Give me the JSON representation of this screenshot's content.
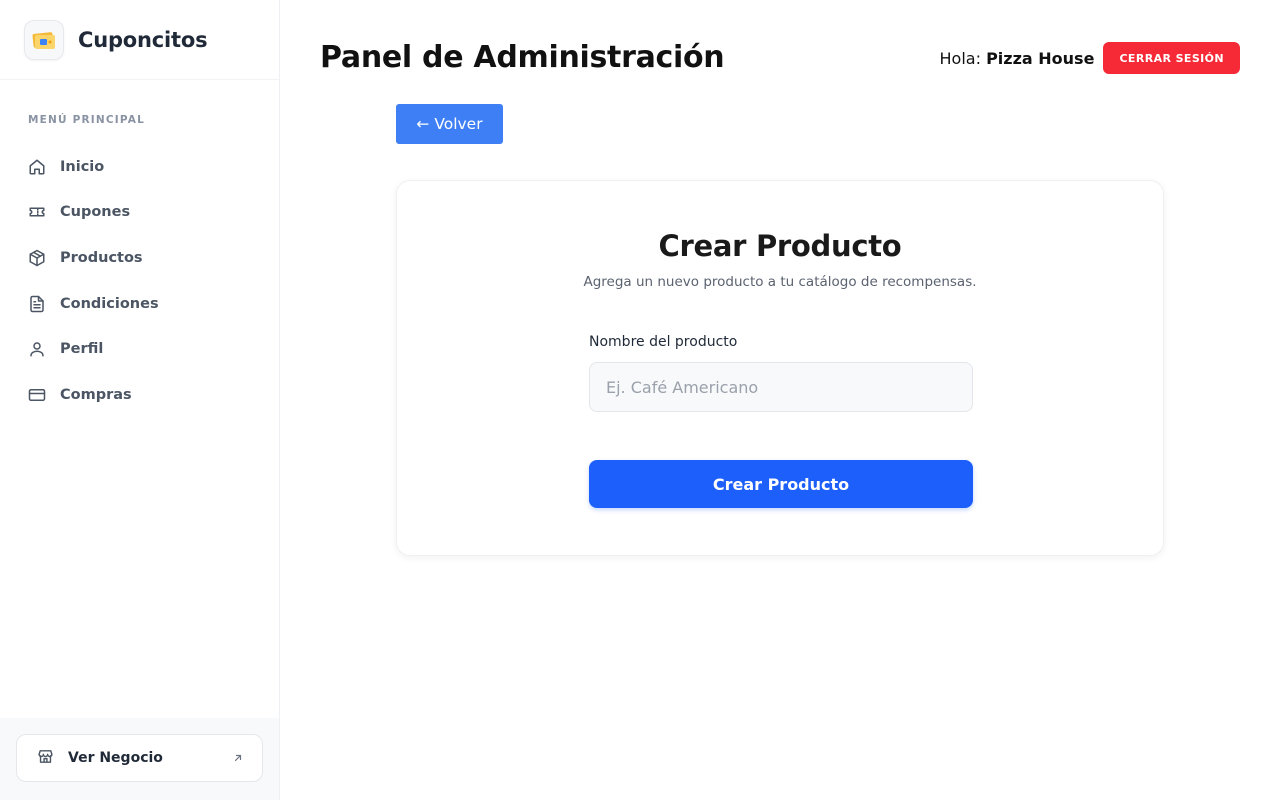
{
  "brand": {
    "name": "Cuponcitos",
    "logo_icon": "coupon-ticket-icon"
  },
  "sidebar": {
    "heading": "MENÚ PRINCIPAL",
    "items": [
      {
        "label": "Inicio",
        "icon": "home-icon"
      },
      {
        "label": "Cupones",
        "icon": "ticket-icon"
      },
      {
        "label": "Productos",
        "icon": "box-icon"
      },
      {
        "label": "Condiciones",
        "icon": "document-icon"
      },
      {
        "label": "Perfil",
        "icon": "user-icon"
      },
      {
        "label": "Compras",
        "icon": "credit-card-icon"
      }
    ],
    "footer": {
      "label": "Ver Negocio",
      "icon": "store-icon",
      "trailing_icon": "arrow-up-right-icon"
    }
  },
  "header": {
    "title": "Panel de Administración",
    "greeting": "Hola:",
    "user": "Pizza House",
    "logout_label": "CERRAR SESIÓN"
  },
  "back_button": {
    "label": "← Volver"
  },
  "form": {
    "title": "Crear Producto",
    "subtitle": "Agrega un nuevo producto a tu catálogo de recompensas.",
    "field_label": "Nombre del producto",
    "field_value": "",
    "field_placeholder": "Ej. Café Americano",
    "submit_label": "Crear Producto"
  },
  "colors": {
    "primary": "#1d5ffb",
    "back_button": "#3f7ff6",
    "danger": "#f52a36",
    "sidebar_text": "#4b5563"
  }
}
